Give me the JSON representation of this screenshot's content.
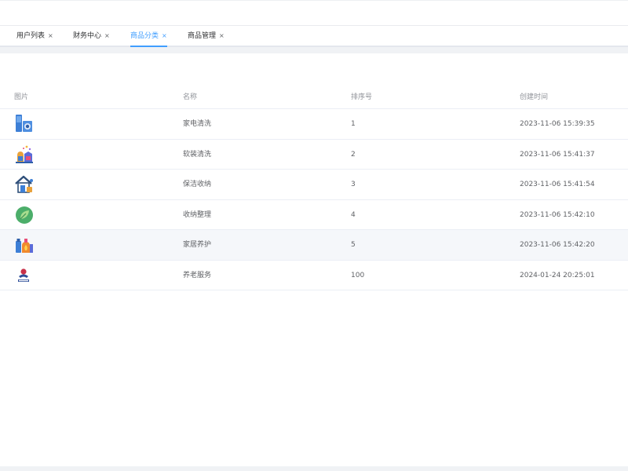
{
  "tabs": [
    {
      "label": "用户列表",
      "close": "×",
      "active": false
    },
    {
      "label": "财务中心",
      "close": "×",
      "active": false
    },
    {
      "label": "商品分类",
      "close": "×",
      "active": true
    },
    {
      "label": "商品管理",
      "close": "×",
      "active": false
    }
  ],
  "table": {
    "headers": {
      "image": "图片",
      "name": "名称",
      "sort": "排序号",
      "created": "创建时间"
    },
    "rows": [
      {
        "icon": "appliance-cleaning-icon",
        "name": "家电清洗",
        "sort": "1",
        "created": "2023-11-06 15:39:35"
      },
      {
        "icon": "soft-furnishing-cleaning-icon",
        "name": "软装清洗",
        "sort": "2",
        "created": "2023-11-06 15:41:37"
      },
      {
        "icon": "house-cleaning-icon",
        "name": "保洁收纳",
        "sort": "3",
        "created": "2023-11-06 15:41:54"
      },
      {
        "icon": "leaf-icon",
        "name": "收纳整理",
        "sort": "4",
        "created": "2023-11-06 15:42:10"
      },
      {
        "icon": "home-care-icon",
        "name": "家居养护",
        "sort": "5",
        "created": "2023-11-06 15:42:20"
      },
      {
        "icon": "elderly-care-logo-icon",
        "name": "养老服务",
        "sort": "100",
        "created": "2024-01-24 20:25:01"
      }
    ]
  },
  "colors": {
    "accent": "#409eff",
    "row_hover": "#f5f7fa",
    "header_text": "#909399",
    "body_text": "#606266"
  }
}
